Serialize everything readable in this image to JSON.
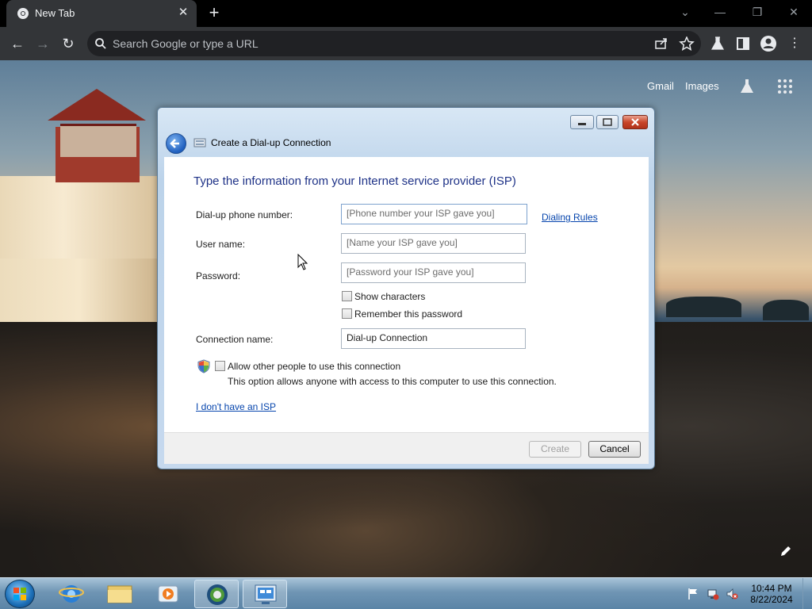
{
  "browser": {
    "tab_title": "New Tab",
    "omnibox_placeholder": "Search Google or type a URL"
  },
  "newtab": {
    "links": [
      "Gmail",
      "Images"
    ]
  },
  "dialog": {
    "title": "Create a Dial-up Connection",
    "heading": "Type the information from your Internet service provider (ISP)",
    "labels": {
      "phone": "Dial-up phone number:",
      "username": "User name:",
      "password": "Password:",
      "connection": "Connection name:"
    },
    "fields": {
      "phone": "[Phone number your ISP gave you]",
      "username": "[Name your ISP gave you]",
      "password": "[Password your ISP gave you]",
      "connection": "Dial-up Connection"
    },
    "dialing_rules": "Dialing Rules",
    "show_characters": "Show characters",
    "remember_password": "Remember this password",
    "allow_others": "Allow other people to use this connection",
    "allow_others_desc": "This option allows anyone with access to this computer to use this connection.",
    "no_isp": "I don't have an ISP",
    "create_button": "Create",
    "cancel_button": "Cancel"
  },
  "taskbar": {
    "time": "10:44 PM",
    "date": "8/22/2024"
  },
  "colors": {
    "chrome_bg": "#333538",
    "heading_blue": "#1e3287",
    "link_blue": "#0645ad"
  }
}
